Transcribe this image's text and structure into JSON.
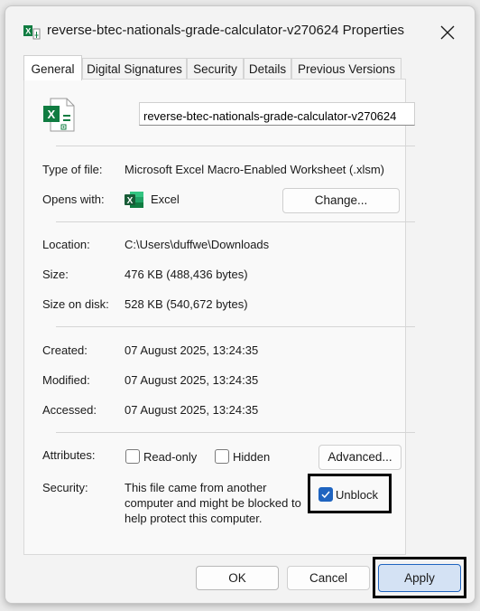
{
  "window": {
    "title": "reverse-btec-nationals-grade-calculator-v270624 Properties"
  },
  "tabs": [
    {
      "label": "General",
      "active": true
    },
    {
      "label": "Digital Signatures",
      "active": false
    },
    {
      "label": "Security",
      "active": false
    },
    {
      "label": "Details",
      "active": false
    },
    {
      "label": "Previous Versions",
      "active": false
    }
  ],
  "general": {
    "file_name": "reverse-btec-nationals-grade-calculator-v270624",
    "type_label": "Type of file:",
    "type_value": "Microsoft Excel Macro-Enabled Worksheet (.xlsm)",
    "opens_label": "Opens with:",
    "opens_value": "Excel",
    "change_button": "Change...",
    "location_label": "Location:",
    "location_value": "C:\\Users\\duffwe\\Downloads",
    "size_label": "Size:",
    "size_value": "476 KB (488,436 bytes)",
    "size_on_disk_label": "Size on disk:",
    "size_on_disk_value": "528 KB (540,672 bytes)",
    "created_label": "Created:",
    "created_value": "07 August 2025, 13:24:35",
    "modified_label": "Modified:",
    "modified_value": "07 August 2025, 13:24:35",
    "accessed_label": "Accessed:",
    "accessed_value": "07 August 2025, 13:24:35",
    "attributes_label": "Attributes:",
    "readonly_label": "Read-only",
    "readonly_checked": false,
    "hidden_label": "Hidden",
    "hidden_checked": false,
    "advanced_button": "Advanced...",
    "security_label": "Security:",
    "security_text_1": "This file came from another",
    "security_text_2": "computer and might be blocked to",
    "security_text_3": "help protect this computer.",
    "unblock_label": "Unblock",
    "unblock_checked": true
  },
  "footer": {
    "ok_button": "OK",
    "cancel_button": "Cancel",
    "apply_button": "Apply"
  },
  "colors": {
    "excel_green": "#107c41",
    "accent_blue": "#1f64c0",
    "apply_fill": "#d4e2f4"
  },
  "icons": [
    "excel-file-icon",
    "close-icon",
    "excel-app-icon",
    "checkmark-icon"
  ]
}
